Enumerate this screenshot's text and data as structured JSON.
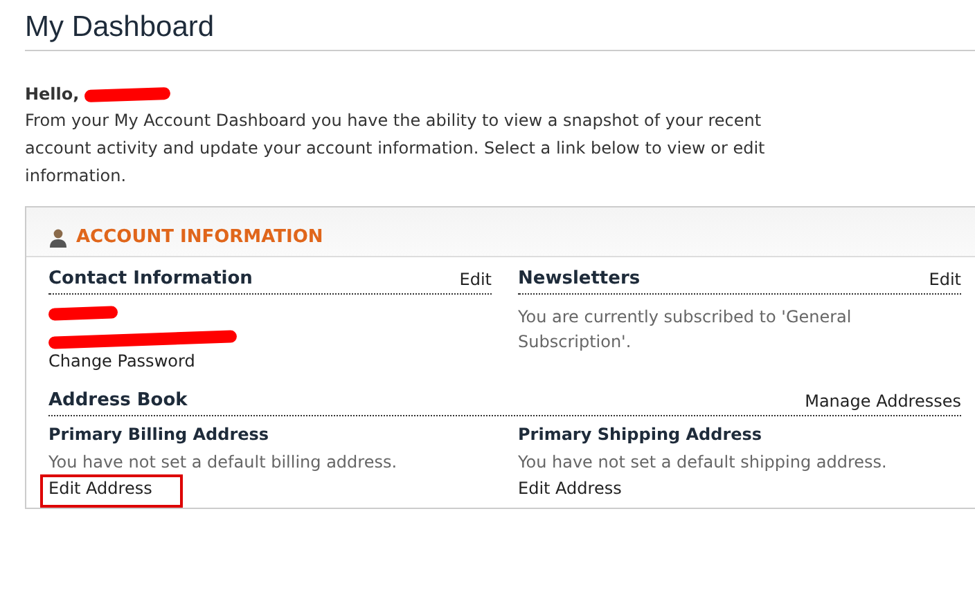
{
  "page_title": "My Dashboard",
  "greeting": "Hello,",
  "intro": "From your My Account Dashboard you have the ability to view a snapshot of your recent account activity and update your account information. Select a link below to view or edit information.",
  "panel": {
    "title": "ACCOUNT INFORMATION",
    "contact": {
      "heading": "Contact Information",
      "edit": "Edit",
      "link": "Change Password"
    },
    "newsletters": {
      "heading": "Newsletters",
      "edit": "Edit",
      "text": "You are currently subscribed to 'General Subscription'."
    },
    "address_book": {
      "heading": "Address Book",
      "manage": "Manage Addresses",
      "addresses": [
        {
          "heading": "Primary Billing Address",
          "text": "You have not set a default billing address.",
          "link": "Edit Address",
          "highlighted": true
        },
        {
          "heading": "Primary Shipping Address",
          "text": "You have not set a default shipping address.",
          "link": "Edit Address",
          "highlighted": false
        }
      ]
    }
  }
}
